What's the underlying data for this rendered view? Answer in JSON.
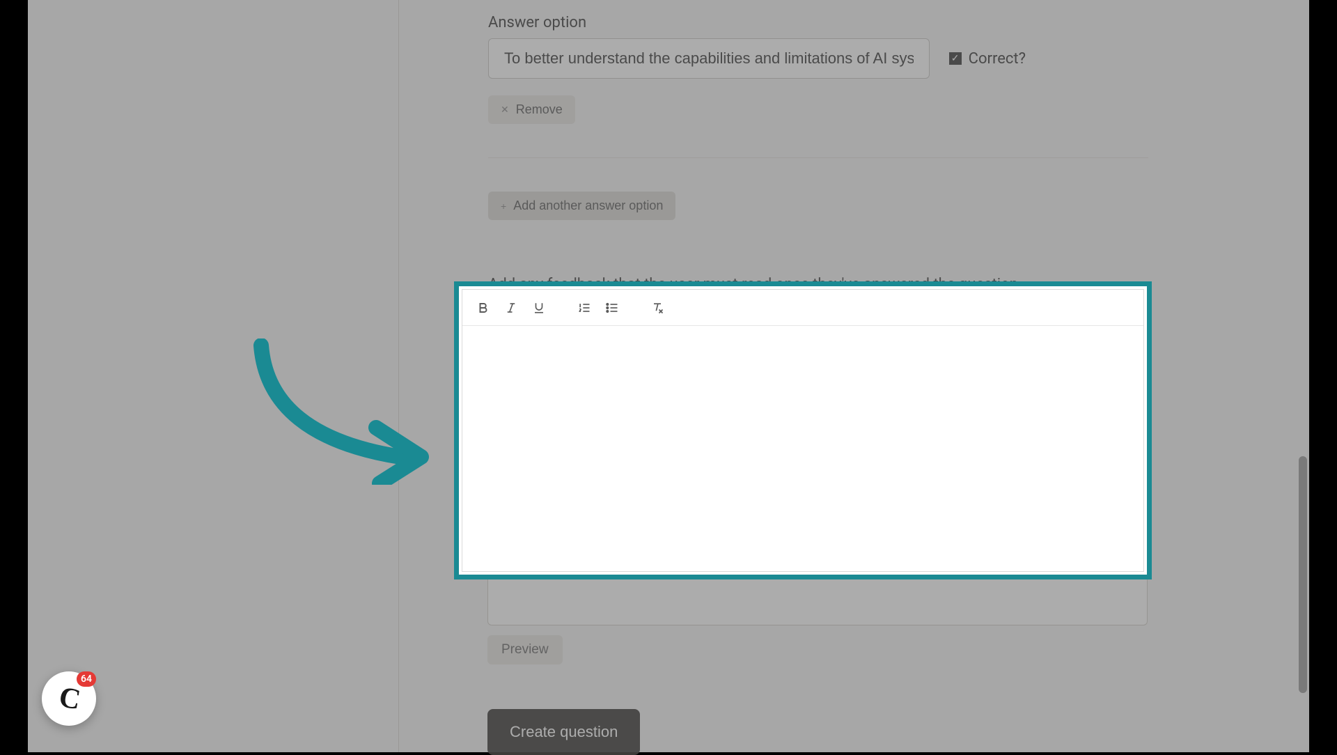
{
  "answer": {
    "label": "Answer option",
    "value": "To better understand the capabilities and limitations of AI systems",
    "correct_label": "Correct?",
    "correct_checked": true,
    "remove_label": "Remove"
  },
  "add_option_label": "Add another answer option",
  "feedback_label": "Add any feedback that the user must read once they've answered the question.",
  "editor": {
    "content": ""
  },
  "preview_label": "Preview",
  "create_label": "Create question",
  "chat": {
    "badge": "64"
  },
  "colors": {
    "highlight_border": "#1a8a93",
    "badge": "#e53935",
    "primary_button": "#3d3b38"
  }
}
